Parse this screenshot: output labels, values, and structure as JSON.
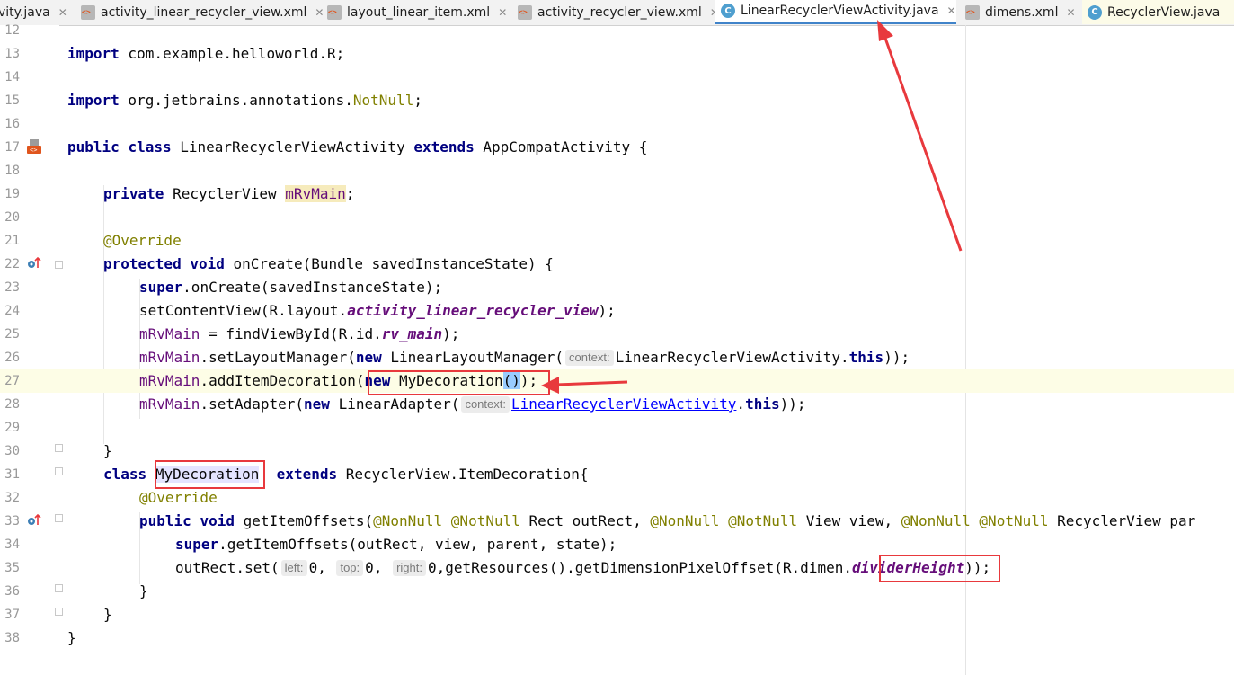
{
  "tabs": [
    {
      "label": "vity.java",
      "icon": "java-class-icon",
      "active": false
    },
    {
      "label": "activity_linear_recycler_view.xml",
      "icon": "xml-file-icon",
      "active": false
    },
    {
      "label": "layout_linear_item.xml",
      "icon": "xml-file-icon",
      "active": false
    },
    {
      "label": "activity_recycler_view.xml",
      "icon": "xml-file-icon",
      "active": false
    },
    {
      "label": "LinearRecyclerViewActivity.java",
      "icon": "java-class-icon",
      "active": true
    },
    {
      "label": "dimens.xml",
      "icon": "xml-file-icon",
      "active": false
    },
    {
      "label": "RecyclerView.java",
      "icon": "java-class-icon",
      "active": false
    }
  ],
  "close_glyph": "✕",
  "class_glyph": "C",
  "line_numbers": [
    "12",
    "13",
    "14",
    "15",
    "16",
    "17",
    "18",
    "19",
    "20",
    "21",
    "22",
    "23",
    "24",
    "25",
    "26",
    "27",
    "28",
    "29",
    "30",
    "31",
    "32",
    "33",
    "34",
    "35",
    "36",
    "37",
    "38"
  ],
  "code": {
    "l13": {
      "kw": "import",
      "rest": " com.example.helloworld.R;"
    },
    "l15": {
      "kw": "import",
      "rest": " org.jetbrains.annotations.",
      "ann": "NotNull",
      "end": ";"
    },
    "l17": {
      "kw1": "public",
      "kw2": "class",
      "name": " LinearRecyclerViewActivity ",
      "kw3": "extends",
      "rest": " AppCompatActivity {"
    },
    "l19": {
      "kw": "private",
      "type": " RecyclerView ",
      "field": "mRvMain",
      "end": ";"
    },
    "l21": {
      "ann": "@Override"
    },
    "l22": {
      "kw1": "protected",
      "kw2": "void",
      "rest": " onCreate(Bundle savedInstanceState) {"
    },
    "l23": {
      "kw": "super",
      "rest": ".onCreate(savedInstanceState);"
    },
    "l24": {
      "pre": "setContentView(R.layout.",
      "field": "activity_linear_recycler_view",
      "end": ");"
    },
    "l25": {
      "field": "mRvMain",
      "pre": " = findViewById(R.id.",
      "field2": "rv_main",
      "end": ");"
    },
    "l26": {
      "field": "mRvMain",
      "pre": ".setLayoutManager(",
      "kw": "new",
      "mid": " LinearLayoutManager(",
      "hint": "context:",
      "post": "LinearRecyclerViewActivity.",
      "kw2": "this",
      "end": "));"
    },
    "l27": {
      "field": "mRvMain",
      "pre": ".addItemDecoration(",
      "kw": "new",
      "mid": " MyDecoration",
      "brace": "()",
      "end": ");"
    },
    "l28": {
      "field": "mRvMain",
      "pre": ".setAdapter(",
      "kw": "new",
      "mid": " LinearAdapter(",
      "hint": "context:",
      "link": "LinearRecyclerViewActivity",
      "dot": ".",
      "kw2": "this",
      "end": "));"
    },
    "l30": {
      "text": "}"
    },
    "l31": {
      "kw": "class",
      "name": "MyDecoration",
      "kw2": "extends",
      "rest": " RecyclerView.ItemDecoration{"
    },
    "l32": {
      "ann": "@Override"
    },
    "l33": {
      "kw1": "public",
      "kw2": "void",
      "pre": " getItemOffsets(",
      "a1": "@NonNull",
      "a2": "@NotNull",
      "p1": " Rect outRect, ",
      "a3": "@NonNull",
      "a4": "@NotNull",
      "p2": " View view, ",
      "a5": "@NonNull",
      "a6": "@NotNull",
      "p3": " RecyclerView par"
    },
    "l34": {
      "kw": "super",
      "rest": ".getItemOffsets(outRect, view, parent, state);"
    },
    "l35": {
      "pre": "outRect.set(",
      "h1": "left:",
      "v1": "0, ",
      "h2": "top:",
      "v2": "0, ",
      "h3": "right:",
      "v3": "0,getResources().getDimensionPixelOffset(R.dimen.",
      "field": "dividerHeight",
      "end": "));"
    },
    "l36": {
      "text": "}"
    },
    "l37": {
      "text": "}"
    },
    "l38": {
      "text": "}"
    }
  },
  "colors": {
    "annotation_red": "#e8393d",
    "active_tab_underline": "#4083c9"
  }
}
